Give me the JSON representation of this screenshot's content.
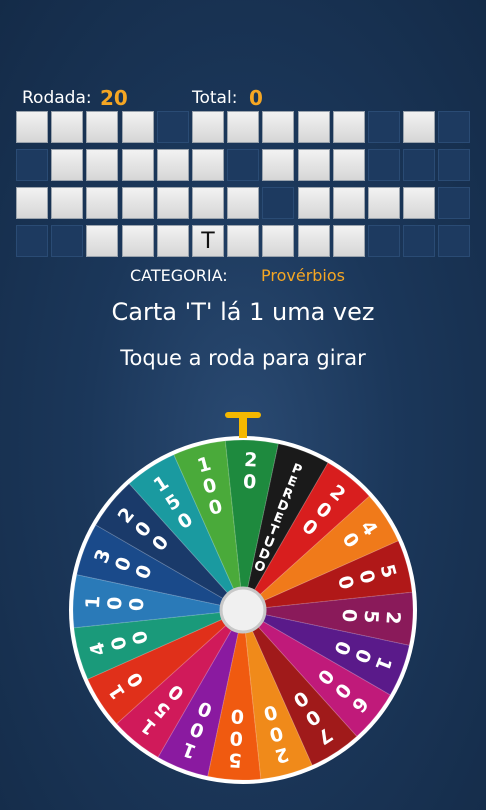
{
  "header": {
    "round_label": "Rodada:",
    "round_value": "20",
    "total_label": "Total:",
    "total_value": "0"
  },
  "board": {
    "rows": [
      "wwww.wwwww.w.",
      ".wwwww.www...",
      "wwwwwww.wwww.",
      "..wwwTwwww..."
    ],
    "revealed_letter": "T"
  },
  "category": {
    "label": "CATEGORIA:",
    "value": "Provérbios"
  },
  "messages": {
    "status": "Carta 'T' lá 1 uma vez",
    "instruction": "Toque a roda para girar"
  },
  "wheel": {
    "segments": [
      {
        "label": "20",
        "color": "#1e8a3e"
      },
      {
        "label": "PERDE TUDO",
        "color": "#1a1a1a"
      },
      {
        "label": "200",
        "color": "#d81e1e"
      },
      {
        "label": "40",
        "color": "#f07a1a"
      },
      {
        "label": "500",
        "color": "#b01818"
      },
      {
        "label": "250",
        "color": "#8a1a5a"
      },
      {
        "label": "100",
        "color": "#5a1a8a"
      },
      {
        "label": "600",
        "color": "#c01a7a"
      },
      {
        "label": "700",
        "color": "#a01a1a"
      },
      {
        "label": "200",
        "color": "#f08a1a"
      },
      {
        "label": "500",
        "color": "#f05a10"
      },
      {
        "label": "100",
        "color": "#8a1aa0"
      },
      {
        "label": "150",
        "color": "#d01a5a"
      },
      {
        "label": "10",
        "color": "#e0301a"
      },
      {
        "label": "400",
        "color": "#1a9a7a"
      },
      {
        "label": "100",
        "color": "#2a7ab8"
      },
      {
        "label": "300",
        "color": "#1a4a8a"
      },
      {
        "label": "200",
        "color": "#1a3a6a"
      },
      {
        "label": "150",
        "color": "#1a9aa0"
      },
      {
        "label": "100",
        "color": "#4aaa3a"
      }
    ],
    "pointer_color": "#f5b800"
  }
}
